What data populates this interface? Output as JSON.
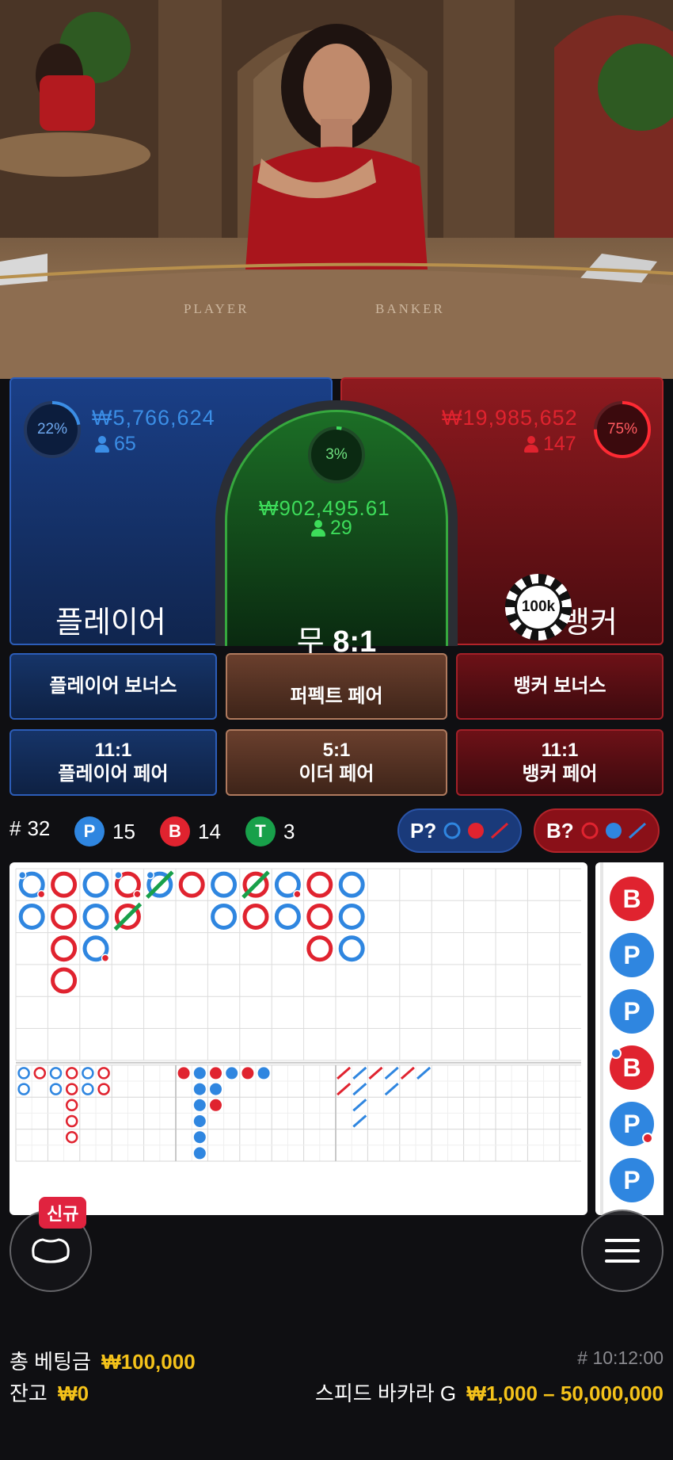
{
  "table": {
    "player_word": "PLAYER",
    "banker_word": "BANKER"
  },
  "player": {
    "percent_text": "22%",
    "percent": 22,
    "amount": "₩5,766,624",
    "count": "65",
    "label": "플레이어"
  },
  "tie": {
    "percent_text": "3%",
    "percent": 3,
    "amount": "₩902,495.61",
    "count": "29",
    "label": "무",
    "payout": "8:1"
  },
  "banker": {
    "percent_text": "75%",
    "percent": 75,
    "amount": "₩19,985,652",
    "count": "147",
    "label": "뱅커",
    "chip": "100k"
  },
  "side_bets": {
    "player_bonus": "플레이어 보너스",
    "perfect_pair": "퍼펙트 페어",
    "banker_bonus": "뱅커 보너스",
    "player_pair_odds": "11:1",
    "player_pair": "플레이어 페어",
    "either_pair_odds": "5:1",
    "either_pair": "이더 페어",
    "banker_pair_odds": "11:1",
    "banker_pair": "뱅커 페어"
  },
  "stats": {
    "rounds_prefix": "#",
    "rounds": "32",
    "p_letter": "P",
    "p_count": "15",
    "b_letter": "B",
    "b_count": "14",
    "t_letter": "T",
    "t_count": "3"
  },
  "predict": {
    "player_label": "P?",
    "banker_label": "B?"
  },
  "big_road": [
    [
      {
        "c": "blue",
        "tl": "blue",
        "br": "red"
      },
      {
        "c": "blue"
      }
    ],
    [
      {
        "c": "red"
      },
      {
        "c": "red"
      },
      {
        "c": "red"
      },
      {
        "c": "red"
      }
    ],
    [
      {
        "c": "blue"
      },
      {
        "c": "blue"
      },
      {
        "c": "blue",
        "br": "red"
      }
    ],
    [
      {
        "c": "red",
        "tl": "blue",
        "br": "red"
      },
      {
        "c": "red",
        "tie": true
      }
    ],
    [
      {
        "c": "blue",
        "tl": "blue",
        "tie": true
      }
    ],
    [
      {
        "c": "red"
      }
    ],
    [
      {
        "c": "blue"
      },
      {
        "c": "blue"
      }
    ],
    [
      {
        "c": "red",
        "tie": true
      },
      {
        "c": "red"
      }
    ],
    [
      {
        "c": "blue",
        "br": "red"
      },
      {
        "c": "blue"
      }
    ],
    [
      {
        "c": "red"
      },
      {
        "c": "red"
      },
      {
        "c": "red"
      }
    ],
    [
      {
        "c": "blue"
      },
      {
        "c": "blue"
      },
      {
        "c": "blue"
      }
    ]
  ],
  "small_road_1": [
    [
      "blue",
      "blue"
    ],
    [
      "red"
    ],
    [
      "blue",
      "blue"
    ],
    [
      "red",
      "red",
      "red",
      "red",
      "red"
    ],
    [
      "blue",
      "blue"
    ],
    [
      "red",
      "red"
    ]
  ],
  "small_road_2": [
    [
      "red"
    ],
    [
      "blue",
      "blue",
      "blue",
      "blue",
      "blue",
      "blue"
    ],
    [
      "red",
      "blue",
      "red"
    ],
    [
      "blue"
    ],
    [
      "red"
    ],
    [
      "blue"
    ]
  ],
  "small_road_3": [
    [
      "red",
      "red"
    ],
    [
      "blue",
      "blue",
      "blue",
      "blue"
    ],
    [
      "red"
    ],
    [
      "blue",
      "blue"
    ],
    [
      "red"
    ],
    [
      "blue"
    ]
  ],
  "history": [
    {
      "letter": "B",
      "color": "red"
    },
    {
      "letter": "P",
      "color": "blue"
    },
    {
      "letter": "P",
      "color": "blue"
    },
    {
      "letter": "B",
      "color": "red",
      "tl": "blue"
    },
    {
      "letter": "P",
      "color": "blue",
      "br": "red"
    },
    {
      "letter": "P",
      "color": "blue"
    }
  ],
  "badge_new": "신규",
  "footer": {
    "total_bet_label": "총 베팅금",
    "total_bet": "₩100,000",
    "balance_label": "잔고",
    "balance": "₩0",
    "round_id": "# 10:12:00",
    "game_name": "스피드 바카라 G",
    "limits": "₩1,000 – 50,000,000"
  },
  "colors": {
    "blue": "#2f86e0",
    "red": "#e0232f",
    "green": "#18a04a",
    "gold": "#f4c21a"
  }
}
